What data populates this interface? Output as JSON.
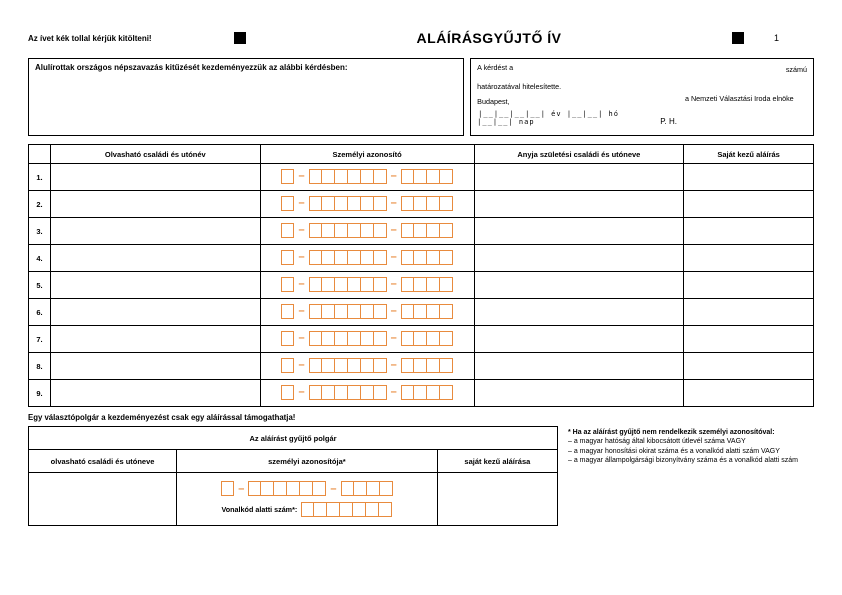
{
  "top": {
    "instruction": "Az ívet kék tollal kérjük kitölteni!",
    "title": "ALÁÍRÁSGYŰJTŐ ÍV",
    "page_number": "1"
  },
  "header_left": "Alulírottak országos népszavazás kitűzését kezdeményezzük az alábbi kérdésben:",
  "header_right": {
    "line1": "A kérdést a",
    "line2": "határozatával hitelesítette.",
    "city": "Budapest,",
    "date_tpl": "󠀠󠀠󠀠󠀠|__|__|__|__| év |__|__| hó |__|__| nap",
    "ph": "P. H.",
    "szamu": "számú",
    "signed_by": "a Nemzeti Választási Iroda elnöke"
  },
  "table": {
    "headers": [
      "",
      "Olvasható családi és utónév",
      "Személyi azonosító",
      "Anyja születési családi és utóneve",
      "Saját kezű aláírás"
    ],
    "rows": [
      "1.",
      "2.",
      "3.",
      "4.",
      "5.",
      "6.",
      "7.",
      "8.",
      "9."
    ]
  },
  "note_single": "Egy választópolgár a kezdeményezést csak egy aláírással támogathatja!",
  "collector": {
    "title": "Az aláírást gyűjtő polgár",
    "cols": [
      "olvasható családi és utóneve",
      "személyi azonosítója*",
      "saját kezű aláírása"
    ],
    "barcode_label": "Vonalkód alatti szám*:"
  },
  "footnotes": {
    "head": "* Ha az aláírást gyűjtő nem rendelkezik személyi azonosítóval:",
    "l1": "– a magyar hatóság által kibocsátott útlevél száma VAGY",
    "l2": "– a magyar honosítási okirat száma és a vonalkód alatti szám VAGY",
    "l3": "– a magyar állampolgársági bizonyítvány száma és a vonalkód alatti szám"
  }
}
